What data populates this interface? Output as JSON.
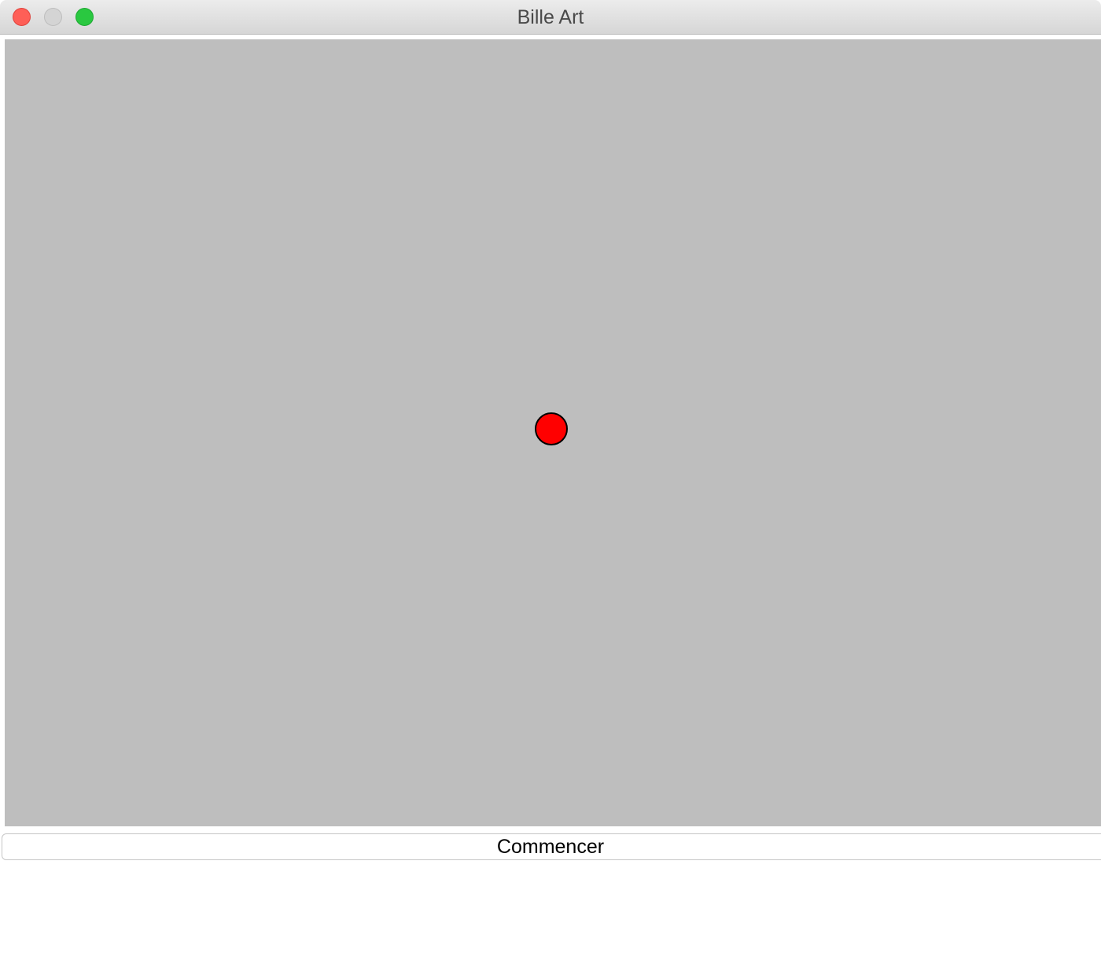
{
  "window": {
    "title": "Bille Art",
    "controls": {
      "close": "#fe5f57",
      "minimize": "#d4d4d4",
      "zoom": "#2ac840"
    }
  },
  "canvas": {
    "background": "#bebebe",
    "ball": {
      "color": "#ff0000",
      "outline": "#000000"
    }
  },
  "start_button": {
    "label": "Commencer"
  }
}
